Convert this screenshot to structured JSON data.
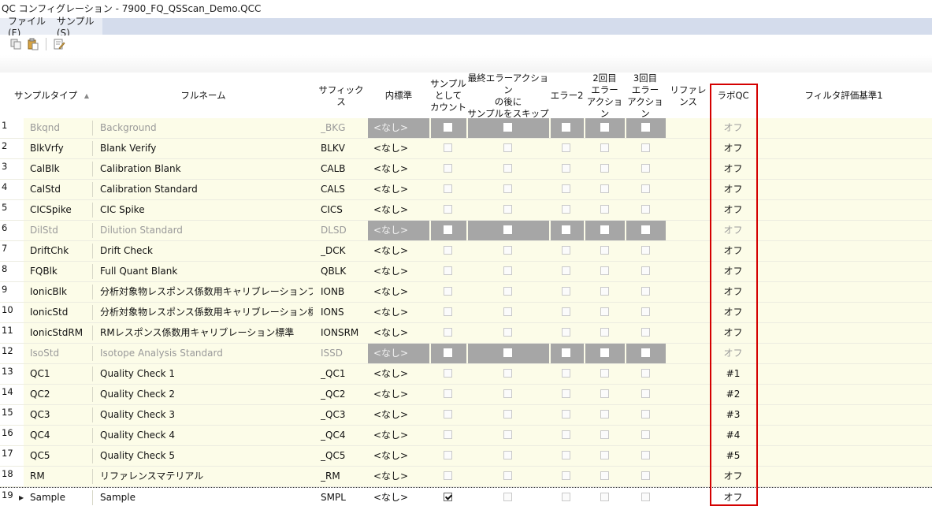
{
  "window": {
    "title": "QC コンフィグレーション - 7900_FQ_QSScan_Demo.QCC"
  },
  "menu": {
    "file": "ファイル(F)",
    "sample": "サンプル(S)"
  },
  "toolbar": {
    "icons": [
      "copy-icon",
      "paste-icon",
      "edit-icon"
    ]
  },
  "columns": {
    "sample_type": "サンプルタイプ",
    "full_name": "フルネーム",
    "suffix": "サフィックス",
    "internal_std": "内標準",
    "count_as_sample": "サンプル\nとして\nカウント",
    "skip_after_error": "最終エラーアクション\nの後に\nサンプルをスキップ",
    "error2": "エラー2",
    "second_error_action": "2回目\nエラー\nアクション",
    "third_error_action": "3回目\nエラー\nアクション",
    "reference": "リファレンス",
    "lab_qc": "ラボQC",
    "filter_criteria": "フィルタ評価基準1"
  },
  "rows": [
    {
      "num": "1",
      "type": "Bkqnd",
      "full": "Background",
      "suffix": "_BKG",
      "internal": "<なし>",
      "lab_qc": "オフ",
      "disabled": true,
      "count_checked": false
    },
    {
      "num": "2",
      "type": "BlkVrfy",
      "full": "Blank Verify",
      "suffix": "BLKV",
      "internal": "<なし>",
      "lab_qc": "オフ",
      "disabled": false,
      "count_checked": false
    },
    {
      "num": "3",
      "type": "CalBlk",
      "full": "Calibration Blank",
      "suffix": "CALB",
      "internal": "<なし>",
      "lab_qc": "オフ",
      "disabled": false,
      "count_checked": false
    },
    {
      "num": "4",
      "type": "CalStd",
      "full": "Calibration Standard",
      "suffix": "CALS",
      "internal": "<なし>",
      "lab_qc": "オフ",
      "disabled": false,
      "count_checked": false
    },
    {
      "num": "5",
      "type": "CICSpike",
      "full": "CIC Spike",
      "suffix": "CICS",
      "internal": "<なし>",
      "lab_qc": "オフ",
      "disabled": false,
      "count_checked": false
    },
    {
      "num": "6",
      "type": "DilStd",
      "full": "Dilution Standard",
      "suffix": "DLSD",
      "internal": "<なし>",
      "lab_qc": "オフ",
      "disabled": true,
      "count_checked": false
    },
    {
      "num": "7",
      "type": "DriftChk",
      "full": "Drift Check",
      "suffix": "_DCK",
      "internal": "<なし>",
      "lab_qc": "オフ",
      "disabled": false,
      "count_checked": false
    },
    {
      "num": "8",
      "type": "FQBlk",
      "full": "Full Quant Blank",
      "suffix": "QBLK",
      "internal": "<なし>",
      "lab_qc": "オフ",
      "disabled": false,
      "count_checked": false
    },
    {
      "num": "9",
      "type": "IonicBlk",
      "full": "分析対象物レスポンス係数用キャリブレーションブランク",
      "suffix": "IONB",
      "internal": "<なし>",
      "lab_qc": "オフ",
      "disabled": false,
      "count_checked": false
    },
    {
      "num": "10",
      "type": "IonicStd",
      "full": "分析対象物レスポンス係数用キャリブレーション標準",
      "suffix": "IONS",
      "internal": "<なし>",
      "lab_qc": "オフ",
      "disabled": false,
      "count_checked": false
    },
    {
      "num": "11",
      "type": "IonicStdRM",
      "full": "RMレスポンス係数用キャリブレーション標準",
      "suffix": "IONSRM",
      "internal": "<なし>",
      "lab_qc": "オフ",
      "disabled": false,
      "count_checked": false
    },
    {
      "num": "12",
      "type": "IsoStd",
      "full": "Isotope Analysis Standard",
      "suffix": "ISSD",
      "internal": "<なし>",
      "lab_qc": "オフ",
      "disabled": true,
      "count_checked": false
    },
    {
      "num": "13",
      "type": "QC1",
      "full": "Quality Check 1",
      "suffix": "_QC1",
      "internal": "<なし>",
      "lab_qc": "#1",
      "disabled": false,
      "count_checked": false
    },
    {
      "num": "14",
      "type": "QC2",
      "full": "Quality Check 2",
      "suffix": "_QC2",
      "internal": "<なし>",
      "lab_qc": "#2",
      "disabled": false,
      "count_checked": false
    },
    {
      "num": "15",
      "type": "QC3",
      "full": "Quality Check 3",
      "suffix": "_QC3",
      "internal": "<なし>",
      "lab_qc": "#3",
      "disabled": false,
      "count_checked": false
    },
    {
      "num": "16",
      "type": "QC4",
      "full": "Quality Check 4",
      "suffix": "_QC4",
      "internal": "<なし>",
      "lab_qc": "#4",
      "disabled": false,
      "count_checked": false
    },
    {
      "num": "17",
      "type": "QC5",
      "full": "Quality Check 5",
      "suffix": "_QC5",
      "internal": "<なし>",
      "lab_qc": "#5",
      "disabled": false,
      "count_checked": false
    },
    {
      "num": "18",
      "type": "RM",
      "full": "リファレンスマテリアル",
      "suffix": "_RM",
      "internal": "<なし>",
      "lab_qc": "オフ",
      "disabled": false,
      "count_checked": false
    },
    {
      "num": "19",
      "type": "Sample",
      "full": "Sample",
      "suffix": "SMPL",
      "internal": "<なし>",
      "lab_qc": "オフ",
      "disabled": false,
      "count_checked": true
    }
  ],
  "colors": {
    "row_bg": "#fcfce8",
    "disabled_band": "#a6a6a6",
    "highlight_border": "#d40000",
    "menubar": "#d4dcec"
  }
}
